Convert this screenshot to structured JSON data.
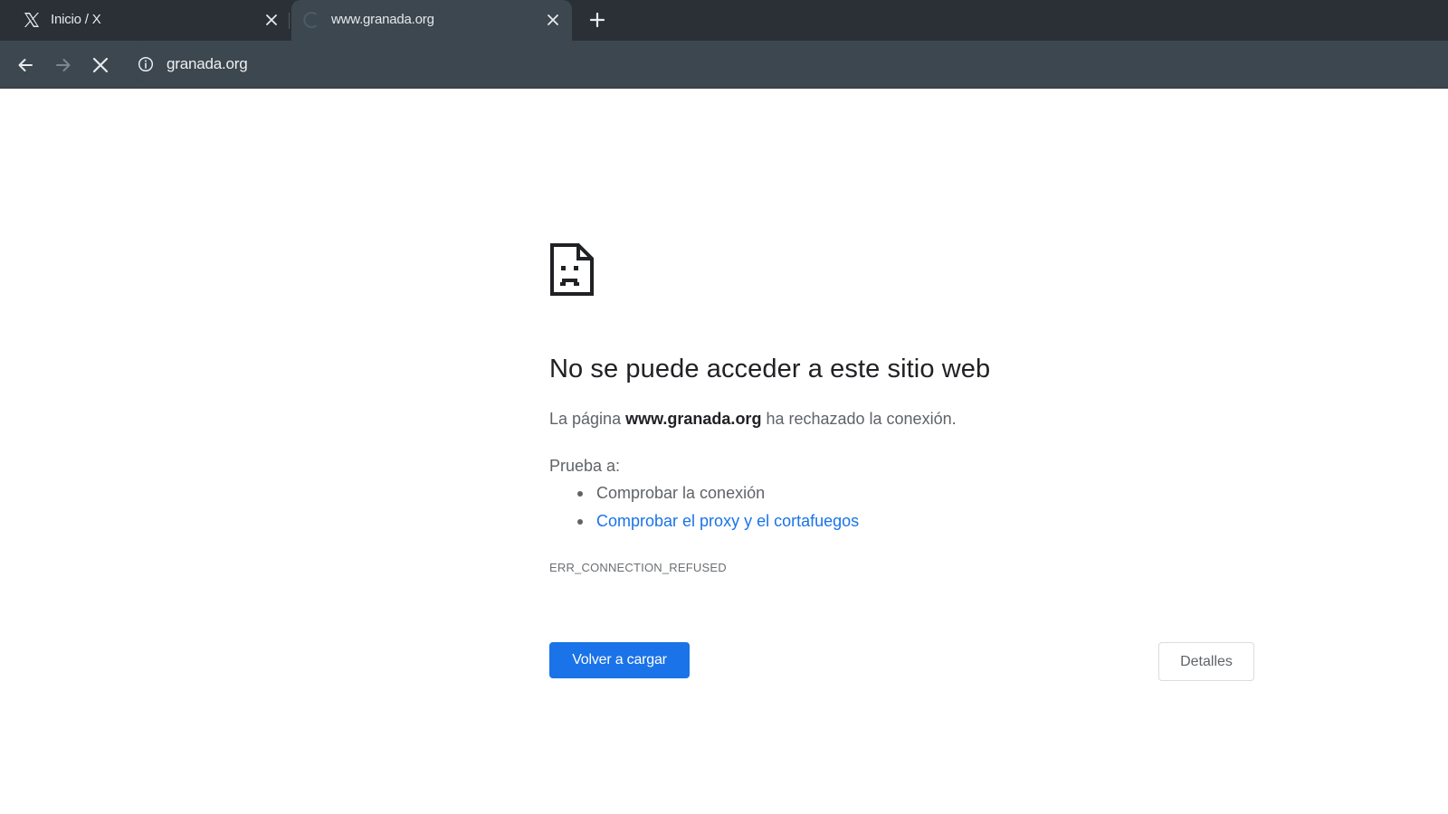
{
  "browser": {
    "tabs": [
      {
        "title": "Inicio / X",
        "favicon": "x-logo-icon",
        "active": false
      },
      {
        "title": "www.granada.org",
        "favicon": "loading-spinner-icon",
        "active": true
      }
    ],
    "new_tab_icon": "plus-icon",
    "toolbar": {
      "back_icon": "arrow-left-icon",
      "forward_icon": "arrow-right-icon",
      "stop_icon": "close-icon",
      "site_info_icon": "info-circle-icon",
      "url": "granada.org"
    },
    "colors": {
      "tabstrip": "#2a3035",
      "toolbar": "#3c474f"
    }
  },
  "error_page": {
    "icon": "sad-page-icon",
    "title": "No se puede acceder a este sitio web",
    "desc_prefix": "La página ",
    "desc_domain": "www.granada.org",
    "desc_suffix": " ha rechazado la conexión.",
    "suggestions_heading": "Prueba a:",
    "suggestions": [
      {
        "text": "Comprobar la conexión",
        "is_link": false
      },
      {
        "text": "Comprobar el proxy y el cortafuegos",
        "is_link": true
      }
    ],
    "error_code": "ERR_CONNECTION_REFUSED",
    "reload_button": "Volver a cargar",
    "details_button": "Detalles",
    "colors": {
      "primary": "#1a73e8",
      "title": "#202124",
      "text": "#5f6368"
    }
  }
}
